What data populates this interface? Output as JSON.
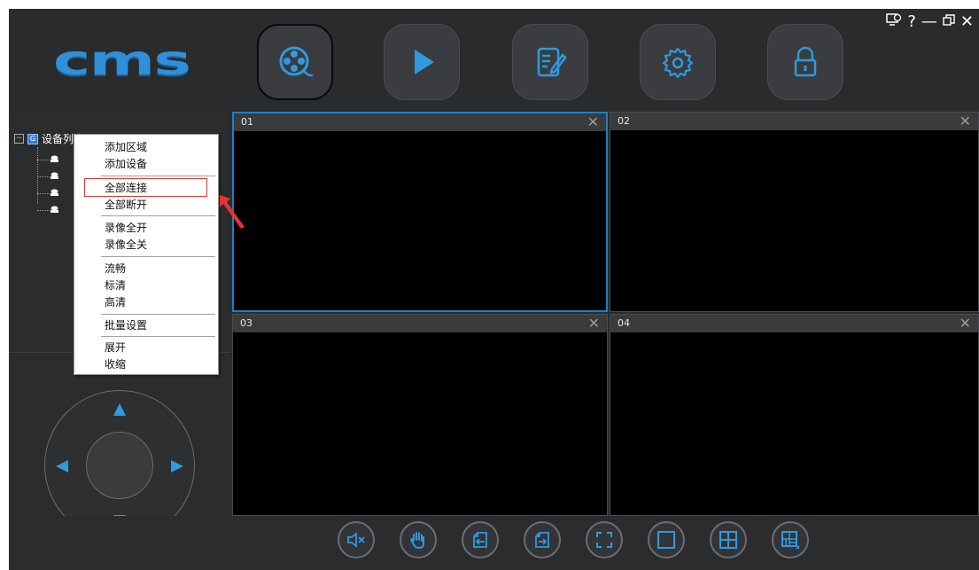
{
  "app": {
    "logo_text": "cms"
  },
  "nav": [
    {
      "name": "live-view",
      "icon": "film-reel-icon"
    },
    {
      "name": "playback",
      "icon": "play-icon"
    },
    {
      "name": "log",
      "icon": "edit-document-icon"
    },
    {
      "name": "settings",
      "icon": "gear-icon"
    },
    {
      "name": "lock",
      "icon": "lock-icon"
    }
  ],
  "window_controls": {
    "extra": "monitor-icon",
    "help": "?",
    "minimize": "—",
    "restore": "restore-icon",
    "close": "✕"
  },
  "tree": {
    "root_label": "设备列表",
    "expander": "⊟",
    "root_icon_letter": "G"
  },
  "context_menu": {
    "items": [
      "添加区域",
      "添加设备",
      "全部连接",
      "全部断开",
      "录像全开",
      "录像全关",
      "流畅",
      "标清",
      "高清",
      "批量设置",
      "展开",
      "收缩"
    ],
    "highlighted": "全部连接"
  },
  "panes": [
    {
      "label": "01",
      "close": "✕"
    },
    {
      "label": "02",
      "close": "✕"
    },
    {
      "label": "03",
      "close": "✕"
    },
    {
      "label": "04",
      "close": "✕"
    }
  ],
  "toolbar": [
    "mute-icon",
    "hand-icon",
    "import-icon",
    "export-icon",
    "fullscreen-icon",
    "single-view-icon",
    "quad-view-icon",
    "multi-view-icon"
  ],
  "colors": {
    "accent": "#2f9ae0",
    "panel": "#2b2c2e",
    "highlight": "#e53333",
    "selected_pane": "#1e7fc7"
  }
}
